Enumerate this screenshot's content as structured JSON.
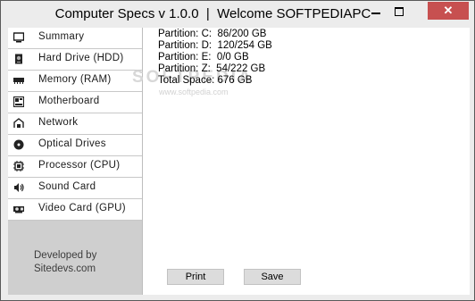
{
  "window": {
    "title": "Computer Specs v 1.0.0  |  Welcome SOFTPEDIAPC",
    "close_glyph": "✕"
  },
  "sidebar": {
    "items": [
      {
        "label": "Summary",
        "icon": "monitor-icon"
      },
      {
        "label": "Hard Drive (HDD)",
        "icon": "hard-drive-icon"
      },
      {
        "label": "Memory (RAM)",
        "icon": "ram-icon"
      },
      {
        "label": "Motherboard",
        "icon": "motherboard-icon"
      },
      {
        "label": "Network",
        "icon": "network-icon"
      },
      {
        "label": "Optical Drives",
        "icon": "disc-icon"
      },
      {
        "label": "Processor (CPU)",
        "icon": "cpu-icon"
      },
      {
        "label": "Sound Card",
        "icon": "speaker-icon"
      },
      {
        "label": "Video Card (GPU)",
        "icon": "gpu-icon"
      }
    ],
    "developer_line1": "Developed by",
    "developer_line2": "Sitedevs.com"
  },
  "content": {
    "lines": [
      "Partition: C:  86/200 GB",
      "Partition: D:  120/254 GB",
      "Partition: E:  0/0 GB",
      "Partition: Z:  54/222 GB",
      "Total Space: 676 GB"
    ],
    "watermark": "SOFTPEDIA",
    "watermark_url": "www.softpedia.com"
  },
  "actions": {
    "print_label": "Print",
    "save_label": "Save"
  }
}
